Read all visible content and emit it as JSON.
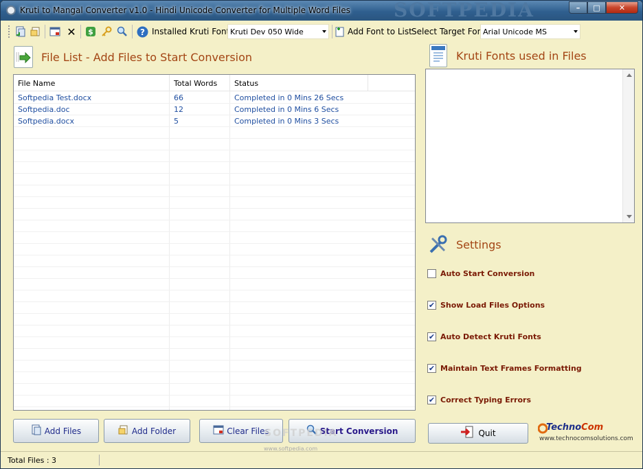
{
  "window": {
    "title": "Kruti to Mangal Converter v1.0 - Hindi Unicode Converter for Multiple Word Files",
    "watermark": "SOFTPEDIA",
    "min_label": "–",
    "max_label": "□",
    "close_label": "✕"
  },
  "toolbar": {
    "installed_label": "Installed Kruti Fonts",
    "installed_value": "Kruti Dev 050 Wide",
    "add_font_label": "Add Font to List",
    "target_label": "Select Target Font",
    "target_value": "Arial Unicode MS"
  },
  "filelist": {
    "title": "File List - Add Files to Start Conversion",
    "columns": [
      "File Name",
      "Total Words",
      "Status"
    ],
    "rows": [
      {
        "name": "Softpedia Test.docx",
        "words": "66",
        "status": "Completed in 0 Mins 26 Secs"
      },
      {
        "name": "Softpedia.doc",
        "words": "12",
        "status": "Completed in 0 Mins 6 Secs"
      },
      {
        "name": "Softpedia.docx",
        "words": "5",
        "status": "Completed in 0 Mins 3 Secs"
      }
    ]
  },
  "fonts_panel": {
    "title": "Kruti Fonts used in Files"
  },
  "settings": {
    "title": "Settings",
    "items": [
      {
        "label": "Auto Start Conversion",
        "checked": false
      },
      {
        "label": "Show Load Files Options",
        "checked": true
      },
      {
        "label": "Auto Detect Kruti Fonts",
        "checked": true
      },
      {
        "label": "Maintain Text Frames Formatting",
        "checked": true
      },
      {
        "label": "Correct Typing Errors",
        "checked": true
      }
    ]
  },
  "buttons": {
    "add_files": "Add Files",
    "add_folder": "Add Folder",
    "clear_files": "Clear Files",
    "start_conversion": "Start Conversion",
    "quit": "Quit"
  },
  "logo": {
    "name_prefix": "Techno",
    "name_suffix": "Com",
    "url": "www.technocomsolutions.com"
  },
  "status": {
    "total_files": "Total Files :  3"
  },
  "watermark": {
    "text": "SOFTPEDIA",
    "url": "www.softpedia.com"
  },
  "colors": {
    "background": "#f4f0c8",
    "section_title": "#a34514",
    "setting_label": "#7a1a05",
    "row_text": "#1f4ea0"
  }
}
